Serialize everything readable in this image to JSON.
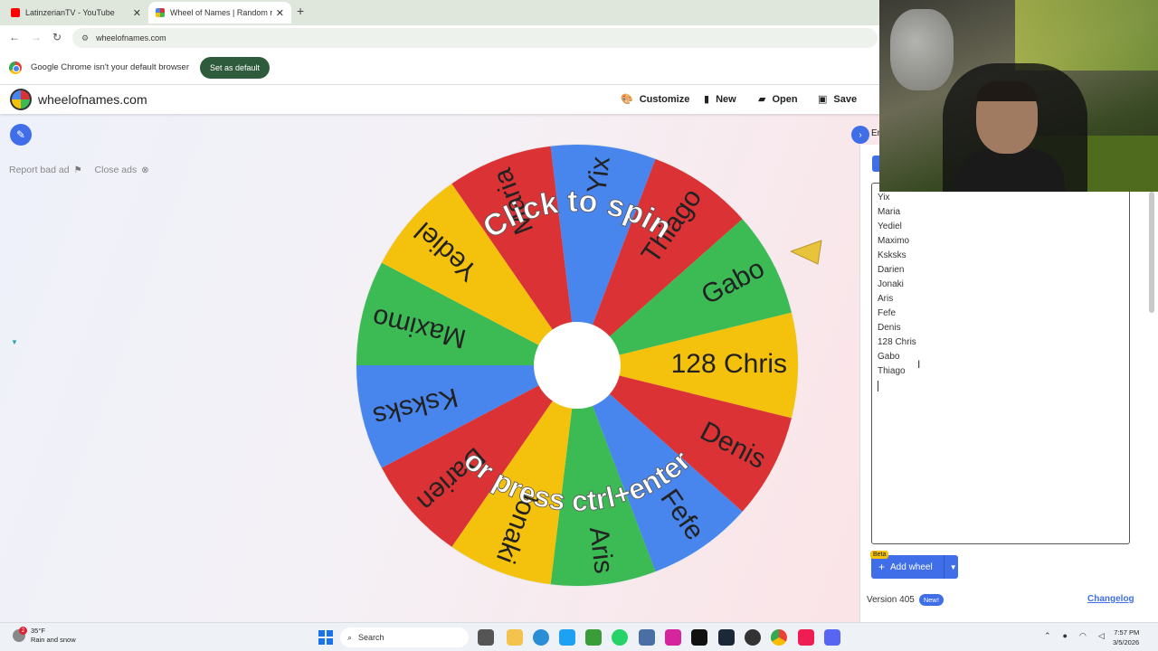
{
  "browser": {
    "tabs": [
      {
        "title": "LatinzerianTV - YouTube",
        "favicon_color": "#ff0000"
      },
      {
        "title": "Wheel of Names | Random nam",
        "favicon_color": "#e34234"
      }
    ],
    "new_tab": "+",
    "url": "wheelofnames.com",
    "infobar": {
      "message": "Google Chrome isn't your default browser",
      "button": "Set as default"
    }
  },
  "app": {
    "name": "wheelofnames.com",
    "toolbar": {
      "customize": "Customize",
      "new": "New",
      "open": "Open",
      "save": "Save"
    },
    "ads": {
      "report": "Report bad ad",
      "close": "Close ads"
    }
  },
  "wheel": {
    "top_text": "Click to spin",
    "bottom_text": "or press ctrl+enter",
    "segments": [
      {
        "name": "128 Chris",
        "color": "#f4c20d"
      },
      {
        "name": "Denis",
        "color": "#db3236"
      },
      {
        "name": "Fefe",
        "color": "#4885ed"
      },
      {
        "name": "Aris",
        "color": "#3cba54"
      },
      {
        "name": "Jonaki",
        "color": "#f4c20d"
      },
      {
        "name": "Darien",
        "color": "#db3236"
      },
      {
        "name": "Ksksks",
        "color": "#4885ed"
      },
      {
        "name": "Maximo",
        "color": "#3cba54"
      },
      {
        "name": "Yediel",
        "color": "#f4c20d"
      },
      {
        "name": "Maria",
        "color": "#db3236"
      },
      {
        "name": "Yix",
        "color": "#4885ed"
      },
      {
        "name": "Thiago",
        "color": "#db3236"
      },
      {
        "name": "Gabo",
        "color": "#3cba54"
      }
    ]
  },
  "panel": {
    "tab_label": "En",
    "entries": [
      "Yix",
      "Maria",
      "Yediel",
      "Maximo",
      "Ksksks",
      "Darien",
      "Jonaki",
      "Aris",
      "Fefe",
      "Denis",
      "128 Chris",
      "Gabo",
      "Thiago"
    ],
    "add_wheel": "Add wheel",
    "beta": "Beta",
    "version": "Version 405",
    "new_badge": "New!",
    "changelog": "Changelog"
  },
  "taskbar": {
    "weather_temp": "35°F",
    "weather_desc": "Rain and snow",
    "weather_badge": "2",
    "search": "Search",
    "time": "7:57 PM",
    "date": "3/5/2026"
  }
}
